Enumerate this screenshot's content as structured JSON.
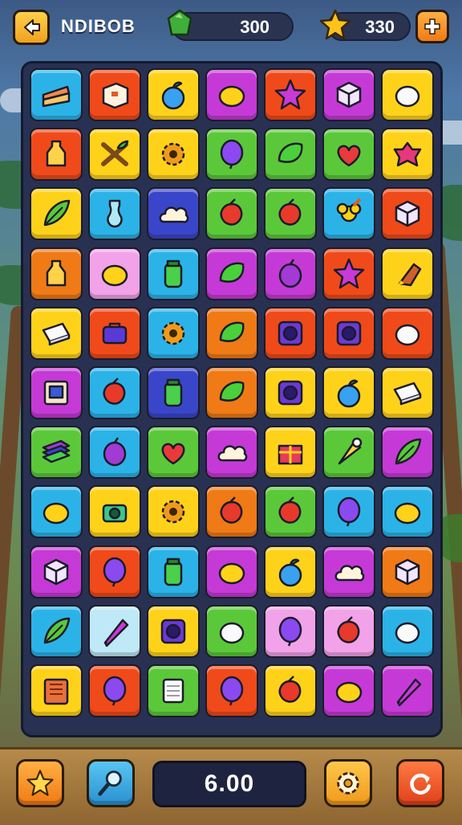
{
  "header": {
    "title": "NDIBOB",
    "gems": {
      "value": "300",
      "icon": "green-gem-icon"
    },
    "stars": {
      "value": "330",
      "icon": "gold-star-icon"
    }
  },
  "footer": {
    "score": "6.00"
  },
  "board": {
    "rows": [
      [
        [
          "#2bb3e8",
          "cake"
        ],
        [
          "#f04a1a",
          "box"
        ],
        [
          "#ffd21a",
          "apple"
        ],
        [
          "#c53ad6",
          "lemon"
        ],
        [
          "#f04a1a",
          "star"
        ],
        [
          "#c53ad6",
          "cube"
        ],
        [
          "#ffd21a",
          "egg"
        ]
      ],
      [
        [
          "#f04a1a",
          "bottle"
        ],
        [
          "#ffd21a",
          "cross"
        ],
        [
          "#ffd21a",
          "gear"
        ],
        [
          "#5bc83a",
          "balloon"
        ],
        [
          "#5bc83a",
          "leaf-blob"
        ],
        [
          "#5bc83a",
          "heart"
        ],
        [
          "#ffd21a",
          "star-blob"
        ]
      ],
      [
        [
          "#ffd21a",
          "leaf"
        ],
        [
          "#2bb3e8",
          "vase"
        ],
        [
          "#3a46c9",
          "cloud"
        ],
        [
          "#5bc83a",
          "berry"
        ],
        [
          "#5bc83a",
          "berry"
        ],
        [
          "#2bb3e8",
          "flower"
        ],
        [
          "#f04a1a",
          "cube"
        ]
      ],
      [
        [
          "#f07a16",
          "bottle"
        ],
        [
          "#f2a2e8",
          "lemon"
        ],
        [
          "#2bb3e8",
          "jar"
        ],
        [
          "#c53ad6",
          "leaf-blob"
        ],
        [
          "#c53ad6",
          "plum"
        ],
        [
          "#f04a1a",
          "star"
        ],
        [
          "#ffd21a",
          "boot"
        ]
      ],
      [
        [
          "#ffd21a",
          "brick"
        ],
        [
          "#f04a1a",
          "bag"
        ],
        [
          "#2bb3e8",
          "gear"
        ],
        [
          "#f07a16",
          "leaf-blob"
        ],
        [
          "#f04a1a",
          "speaker"
        ],
        [
          "#f04a1a",
          "speaker"
        ],
        [
          "#f04a1a",
          "egg"
        ]
      ],
      [
        [
          "#c53ad6",
          "screen"
        ],
        [
          "#2bb3e8",
          "berry"
        ],
        [
          "#3a46c9",
          "jar"
        ],
        [
          "#f07a16",
          "leaf-blob"
        ],
        [
          "#ffd21a",
          "speaker"
        ],
        [
          "#ffd21a",
          "apple"
        ],
        [
          "#ffd21a",
          "brick"
        ]
      ],
      [
        [
          "#5bc83a",
          "books"
        ],
        [
          "#2bb3e8",
          "plum"
        ],
        [
          "#5bc83a",
          "heart"
        ],
        [
          "#c53ad6",
          "cloud"
        ],
        [
          "#ffd21a",
          "gift"
        ],
        [
          "#5bc83a",
          "cone"
        ],
        [
          "#c53ad6",
          "leaf"
        ]
      ],
      [
        [
          "#2bb3e8",
          "lemon"
        ],
        [
          "#ffd21a",
          "camera"
        ],
        [
          "#ffd21a",
          "gear"
        ],
        [
          "#f07a16",
          "berry"
        ],
        [
          "#5bc83a",
          "berry"
        ],
        [
          "#2bb3e8",
          "balloon"
        ],
        [
          "#2bb3e8",
          "lemon"
        ]
      ],
      [
        [
          "#c53ad6",
          "cube"
        ],
        [
          "#f04a1a",
          "balloon"
        ],
        [
          "#2bb3e8",
          "jar"
        ],
        [
          "#c53ad6",
          "lemon"
        ],
        [
          "#ffd21a",
          "apple"
        ],
        [
          "#c53ad6",
          "cloud"
        ],
        [
          "#f07a16",
          "cube"
        ]
      ],
      [
        [
          "#2bb3e8",
          "leaf"
        ],
        [
          "#bfe9f7",
          "pen"
        ],
        [
          "#ffd21a",
          "speaker"
        ],
        [
          "#5bc83a",
          "egg"
        ],
        [
          "#f2a2e8",
          "balloon"
        ],
        [
          "#f2a2e8",
          "berry"
        ],
        [
          "#2bb3e8",
          "egg"
        ]
      ],
      [
        [
          "#ffd21a",
          "book"
        ],
        [
          "#f04a1a",
          "balloon"
        ],
        [
          "#5bc83a",
          "scroll"
        ],
        [
          "#f04a1a",
          "balloon"
        ],
        [
          "#ffd21a",
          "berry"
        ],
        [
          "#c53ad6",
          "lemon"
        ],
        [
          "#c53ad6",
          "pen"
        ]
      ]
    ]
  }
}
